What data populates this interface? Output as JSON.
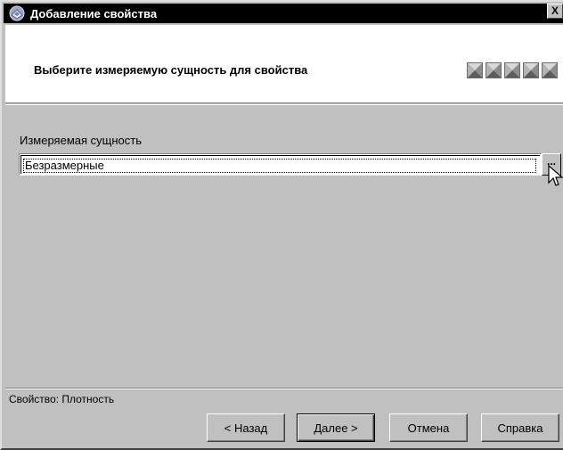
{
  "window": {
    "title": "Добавление свойства",
    "close_label": "X"
  },
  "header": {
    "instruction": "Выберите измеряемую сущность для свойства",
    "step_icons": [
      "step-icon",
      "step-icon",
      "step-icon",
      "step-icon",
      "step-icon"
    ]
  },
  "main": {
    "field_label": "Измеряемая сущность",
    "field_value": "Безразмерные",
    "browse_label": "..."
  },
  "status": {
    "text": "Свойство: Плотность"
  },
  "buttons": {
    "back": "< Назад",
    "next": "Далее >",
    "cancel": "Отмена",
    "help": "Справка"
  }
}
